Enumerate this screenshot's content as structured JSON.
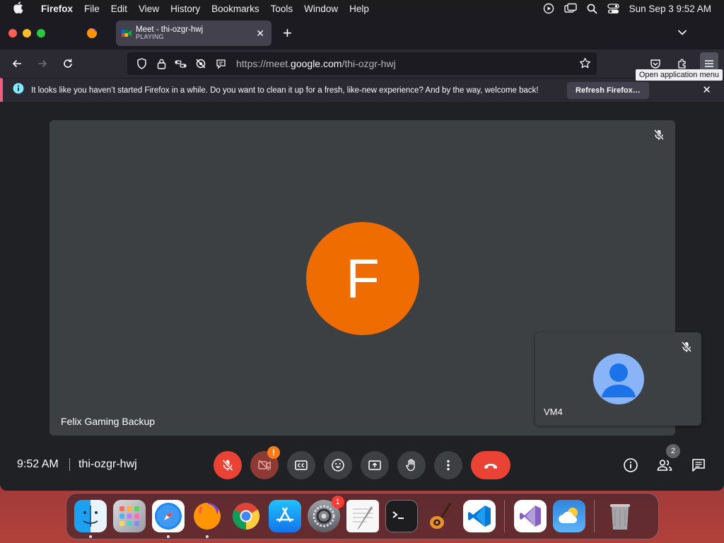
{
  "menubar": {
    "app_name": "Firefox",
    "items": [
      "File",
      "Edit",
      "View",
      "History",
      "Bookmarks",
      "Tools",
      "Window",
      "Help"
    ],
    "clock": "Sun Sep 3  9:52 AM"
  },
  "browser": {
    "tab": {
      "title": "Meet - thi-ozgr-hwj",
      "status": "PLAYING"
    },
    "url": {
      "prefix": "https://meet.",
      "domain": "google.com",
      "path": "/thi-ozgr-hwj"
    },
    "tooltip": "Open application menu"
  },
  "notification": {
    "message": "It looks like you haven’t started Firefox in a while. Do you want to clean it up for a fresh, like-new experience? And by the way, welcome back!",
    "button": "Refresh Firefox…"
  },
  "meet": {
    "main_participant": {
      "initial": "F",
      "name": "Felix Gaming Backup"
    },
    "self_participant": {
      "name": "VM4"
    },
    "time": "9:52 AM",
    "meeting_code": "thi-ozgr-hwj",
    "camera_warning": "!",
    "participant_count": "2"
  },
  "dock": {
    "apps": [
      "Finder",
      "Launchpad",
      "Safari",
      "Firefox",
      "Google Chrome",
      "App Store",
      "System Settings",
      "TextEdit",
      "Terminal",
      "GarageBand",
      "Visual Studio Code",
      "Visual Studio",
      "Weather",
      "Trash"
    ],
    "settings_badge": "1"
  },
  "colors": {
    "meet_bg": "#202124",
    "tile_bg": "#3c4043",
    "avatar_orange": "#ef6c00",
    "danger_red": "#ea4335",
    "notice_accent": "#f15d7f"
  }
}
